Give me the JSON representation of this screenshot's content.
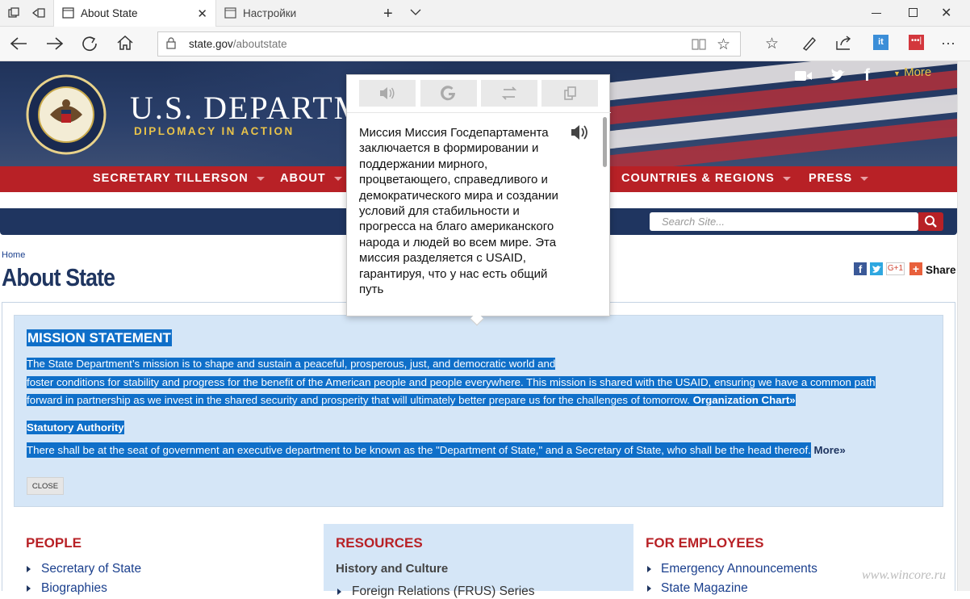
{
  "browser": {
    "tabs": [
      {
        "title": "About State",
        "active": true
      },
      {
        "title": "Настройки",
        "active": false
      }
    ],
    "url_domain": "state.gov",
    "url_path": "/aboutstate"
  },
  "site": {
    "logo_title": "U.S. DEPARTM",
    "logo_subtitle": "DIPLOMACY IN ACTION",
    "more_label": "More",
    "nav": [
      "SECRETARY TILLERSON",
      "ABOUT",
      "COUNTRIES & REGIONS",
      "PRESS"
    ],
    "search_placeholder": "Search Site...",
    "breadcrumb": "Home",
    "page_title": "About State",
    "share_label": "Share",
    "gplus_label": "G+1",
    "mission": {
      "heading": "MISSION STATEMENT",
      "line1": "The State Department’s mission is to shape and sustain a peaceful, prosperous, just, and democratic world and",
      "line2": "foster conditions for stability and progress for the benefit of the American people and people everywhere. This mission is shared with the USAID, ensuring we have a common path",
      "line3": "forward in partnership as we invest in the shared security and prosperity that will ultimately better prepare us for the challenges of tomorrow.",
      "org_chart": "Organization Chart»",
      "statutory_heading": "Statutory Authority",
      "statutory_text": "There shall be at the seat of government an executive department to be known as the \"Department of State,\" and a Secretary of State, who shall be the head thereof.",
      "more_link": "More»",
      "close_label": "CLOSE"
    },
    "columns": {
      "people": {
        "title": "PEOPLE",
        "items": [
          "Secretary of State",
          "Biographies"
        ]
      },
      "resources": {
        "title": "RESOURCES",
        "subtitle": "History and Culture",
        "items": [
          "Foreign Relations (FRUS) Series"
        ]
      },
      "employees": {
        "title": "FOR EMPLOYEES",
        "items": [
          "Emergency Announcements",
          "State Magazine"
        ]
      }
    },
    "watermark": "www.wincore.ru"
  },
  "translator": {
    "text": "Миссия Миссия Госдепартамента заключается в формировании и поддержании мирного, процветающего, справедливого и демократического мира и создании условий для стабильности и прогресса на благо американского народа и людей во всем мире. Эта миссия разделяется с USAID, гарантируя, что у нас есть общий путь"
  },
  "colors": {
    "brand_red": "#b82126",
    "navy": "#1f3560",
    "selection": "#0f6fc9"
  }
}
